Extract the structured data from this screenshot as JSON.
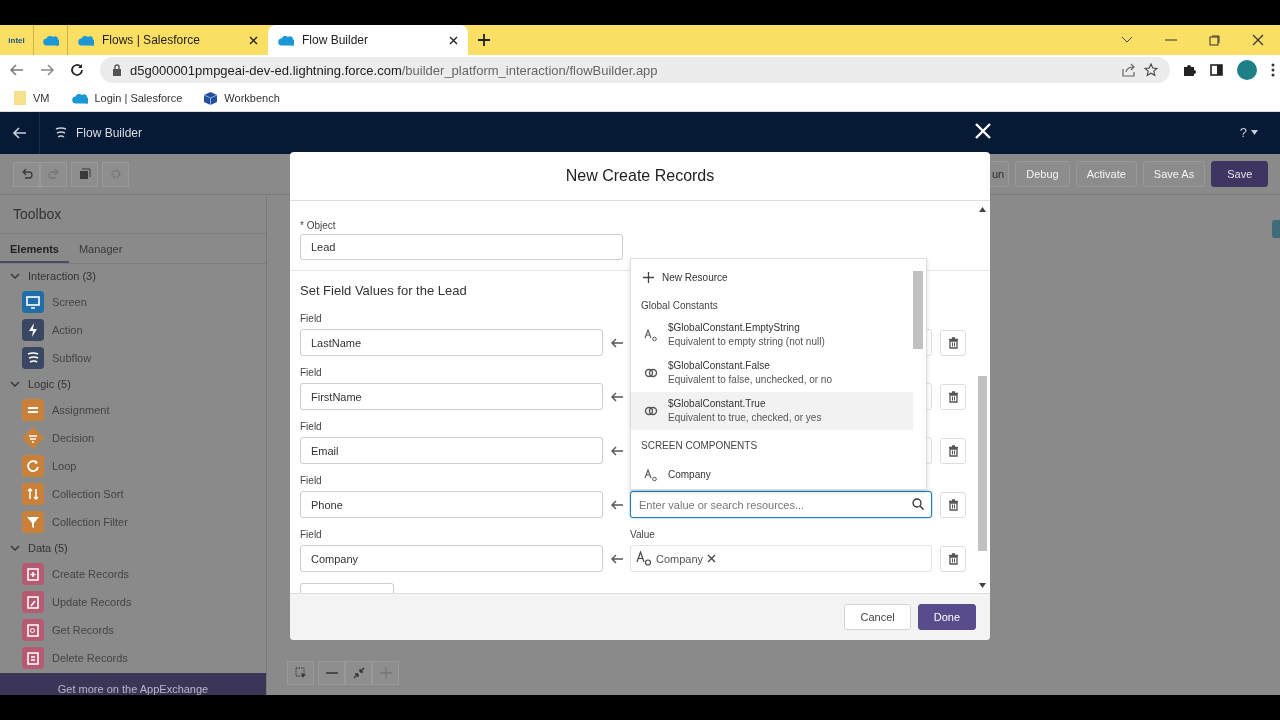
{
  "browser": {
    "pinned": [
      {
        "kind": "intel",
        "label": "intel"
      },
      {
        "kind": "cloud"
      }
    ],
    "tabs": [
      {
        "title": "Flows | Salesforce",
        "selected": false
      },
      {
        "title": "Flow Builder",
        "selected": true
      }
    ],
    "url": {
      "host": "d5g000001pmpgeai-dev-ed.lightning.force.com",
      "path": "/builder_platform_interaction/flowBuilder.app"
    },
    "bookmarks": [
      {
        "label": "VM",
        "kind": "folder"
      },
      {
        "label": "Login | Salesforce",
        "kind": "cloud"
      },
      {
        "label": "Workbench",
        "kind": "cube"
      }
    ]
  },
  "app": {
    "title": "Flow Builder",
    "help": "?"
  },
  "toolbar": {
    "buttons": [
      {
        "label": "un",
        "kind": "neutral",
        "disabled": false
      },
      {
        "label": "Debug",
        "kind": "neutral",
        "disabled": true
      },
      {
        "label": "Activate",
        "kind": "neutral",
        "disabled": true
      },
      {
        "label": "Save As",
        "kind": "neutral",
        "disabled": true
      },
      {
        "label": "Save",
        "kind": "primary",
        "disabled": false
      }
    ]
  },
  "toolbox": {
    "title": "Toolbox",
    "tabs": [
      {
        "label": "Elements",
        "selected": true
      },
      {
        "label": "Manager",
        "selected": false
      }
    ],
    "sections": [
      {
        "label": "Interaction (3)",
        "expanded": true,
        "items": [
          {
            "label": "Screen",
            "kind": "screen",
            "color": "#1f6ea8"
          },
          {
            "label": "Action",
            "kind": "action",
            "color": "#3a4763"
          },
          {
            "label": "Subflow",
            "kind": "subflow",
            "color": "#3a4763"
          }
        ]
      },
      {
        "label": "Logic (5)",
        "expanded": true,
        "items": [
          {
            "label": "Assignment",
            "kind": "assignment",
            "color": "#c9813a"
          },
          {
            "label": "Decision",
            "kind": "decision",
            "color": "#c9813a"
          },
          {
            "label": "Loop",
            "kind": "loop",
            "color": "#c9813a"
          },
          {
            "label": "Collection Sort",
            "kind": "sort",
            "color": "#c9813a"
          },
          {
            "label": "Collection Filter",
            "kind": "filter",
            "color": "#c9813a"
          }
        ]
      },
      {
        "label": "Data (5)",
        "expanded": true,
        "items": [
          {
            "label": "Create Records",
            "kind": "create",
            "color": "#b55a72"
          },
          {
            "label": "Update Records",
            "kind": "update",
            "color": "#b55a72"
          },
          {
            "label": "Get Records",
            "kind": "get",
            "color": "#b55a72"
          },
          {
            "label": "Delete Records",
            "kind": "delete",
            "color": "#b55a72"
          }
        ]
      }
    ],
    "banner": "Get more on the AppExchange"
  },
  "modal": {
    "title": "New Create Records",
    "object": {
      "required_mark": "*",
      "label": "Object",
      "value": "Lead"
    },
    "section_title": "Set Field Values for the Lead",
    "rows": [
      {
        "label": "Field",
        "field": "LastName",
        "kind": "covered"
      },
      {
        "label": "Field",
        "field": "FirstName",
        "kind": "covered"
      },
      {
        "label": "Field",
        "field": "Email",
        "kind": "covered"
      },
      {
        "label": "Field",
        "field": "Phone",
        "kind": "search",
        "placeholder": "Enter value or search resources..."
      },
      {
        "label": "Field",
        "field": "Company",
        "kind": "pill",
        "value_label": "Value",
        "value": "Company"
      }
    ],
    "dropdown": {
      "new_resource": "New Resource",
      "groups": [
        {
          "heading": "Global Constants",
          "items": [
            {
              "name": "$GlobalConstant.EmptyString",
              "description": "Equivalent to empty string (not null)",
              "kind": "text",
              "highlighted": false
            },
            {
              "name": "$GlobalConstant.False",
              "description": "Equivalent to false, unchecked, or no",
              "kind": "boolean",
              "highlighted": false
            },
            {
              "name": "$GlobalConstant.True",
              "description": "Equivalent to true, checked, or yes",
              "kind": "boolean",
              "highlighted": true
            }
          ]
        },
        {
          "heading": "SCREEN COMPONENTS",
          "items": [
            {
              "name": "Company",
              "kind": "text",
              "highlighted": false
            }
          ]
        }
      ]
    },
    "buttons": [
      {
        "label": "Cancel",
        "kind": "neutral"
      },
      {
        "label": "Done",
        "kind": "brand"
      }
    ]
  }
}
